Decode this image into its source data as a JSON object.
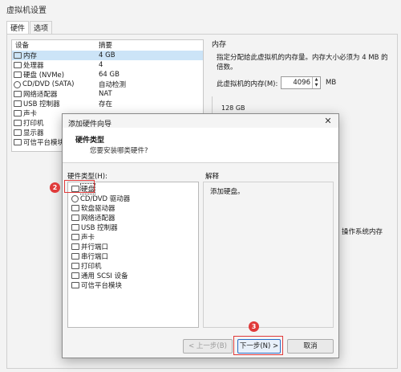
{
  "window": {
    "title": "虚拟机设置"
  },
  "tabs": [
    {
      "label": "硬件"
    },
    {
      "label": "选项"
    }
  ],
  "device_list": {
    "headers": {
      "device": "设备",
      "summary": "摘要"
    },
    "rows": [
      {
        "name": "内存",
        "value": "4 GB",
        "icon": "memory-icon"
      },
      {
        "name": "处理器",
        "value": "4",
        "icon": "cpu-icon"
      },
      {
        "name": "硬盘 (NVMe)",
        "value": "64 GB",
        "icon": "disk-icon"
      },
      {
        "name": "CD/DVD (SATA)",
        "value": "自动检测",
        "icon": "cd-icon"
      },
      {
        "name": "网络适配器",
        "value": "NAT",
        "icon": "network-icon"
      },
      {
        "name": "USB 控制器",
        "value": "存在",
        "icon": "usb-icon"
      },
      {
        "name": "声卡",
        "value": "",
        "icon": "sound-icon"
      },
      {
        "name": "打印机",
        "value": "",
        "icon": "printer-icon"
      },
      {
        "name": "显示器",
        "value": "",
        "icon": "display-icon"
      },
      {
        "name": "可信平台模块",
        "value": "",
        "icon": "tpm-icon"
      }
    ]
  },
  "memory": {
    "title": "内存",
    "description": "指定分配给此虚拟机的内存量。内存大小必须为 4 MB 的倍数。",
    "label": "此虚拟机的内存(M):",
    "value": "4096",
    "unit": "MB",
    "scale_top": "128 GB"
  },
  "background_fragment": "操作系统内存",
  "dialog": {
    "title": "添加硬件向导",
    "heading": "硬件类型",
    "subheading": "您要安装哪类硬件?",
    "type_label": "硬件类型(H):",
    "types": [
      {
        "label": "硬盘",
        "icon": "disk-icon"
      },
      {
        "label": "CD/DVD 驱动器",
        "icon": "cd-icon"
      },
      {
        "label": "软盘驱动器",
        "icon": "floppy-icon"
      },
      {
        "label": "网络适配器",
        "icon": "network-icon"
      },
      {
        "label": "USB 控制器",
        "icon": "usb-icon"
      },
      {
        "label": "声卡",
        "icon": "sound-icon"
      },
      {
        "label": "并行端口",
        "icon": "parallel-port-icon"
      },
      {
        "label": "串行端口",
        "icon": "serial-port-icon"
      },
      {
        "label": "打印机",
        "icon": "printer-icon"
      },
      {
        "label": "通用 SCSI 设备",
        "icon": "scsi-icon"
      },
      {
        "label": "可信平台模块",
        "icon": "tpm-icon"
      }
    ],
    "explain_label": "解释",
    "explain_text": "添加硬盘。",
    "buttons": {
      "back": "< 上一步(B)",
      "next": "下一步(N) >",
      "cancel": "取消"
    },
    "close_symbol": "✕"
  },
  "annotations": {
    "marker_2": "2",
    "marker_3": "3",
    "color": "#e03a3a"
  }
}
